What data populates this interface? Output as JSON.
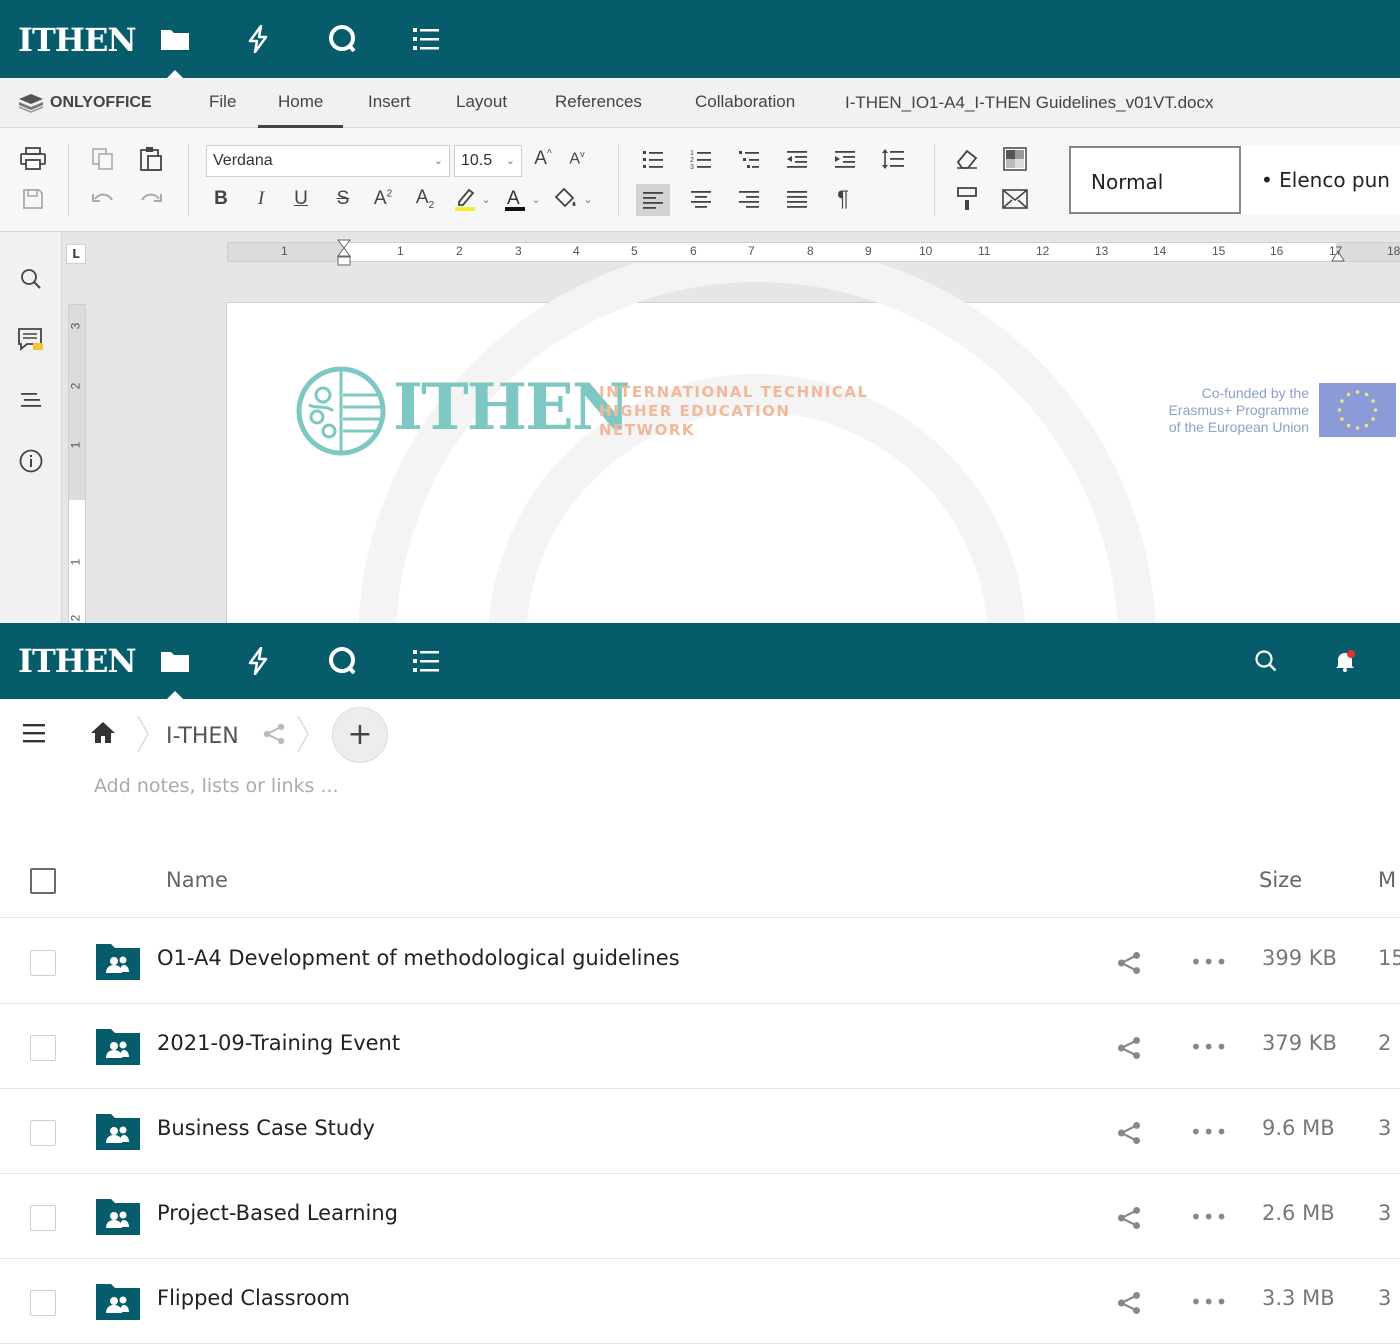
{
  "colors": {
    "header": "#065c6b",
    "ithen_teal": "#7ec8c4",
    "ithen_orange": "#f1b99a",
    "eu_blue": "#8a9bd8"
  },
  "header": {
    "logo": "ITHEN",
    "apps": [
      "files-icon",
      "activity-icon",
      "talk-icon",
      "deck-icon"
    ]
  },
  "editor": {
    "brand": "ONLYOFFICE",
    "tabs": [
      "File",
      "Home",
      "Insert",
      "Layout",
      "References",
      "Collaboration"
    ],
    "active_tab": "Home",
    "document_name": "I-THEN_IO1-A4_I-THEN Guidelines_v01VT.docx",
    "toolbar": {
      "font_name": "Verdana",
      "font_size": "10.5",
      "styles": [
        "Normal",
        "• Elenco pun"
      ]
    },
    "ruler_numbers": [
      "1",
      "1",
      "2",
      "3",
      "4",
      "5",
      "6",
      "7",
      "8",
      "9",
      "10",
      "11",
      "12",
      "13",
      "14",
      "15",
      "16",
      "17",
      "18"
    ],
    "vruler_numbers": [
      "3",
      "2",
      "1",
      "1",
      "2"
    ],
    "page": {
      "logo_word": "ITHEN",
      "logo_sub": [
        "INTERNATIONAL TECHNICAL",
        "HIGHER EDUCATION",
        "NETWORK"
      ],
      "cofund": [
        "Co-funded by the",
        "Erasmus+ Programme",
        "of the European Union"
      ]
    }
  },
  "files": {
    "breadcrumb": "I-THEN",
    "notes_placeholder": "Add notes, lists or links ...",
    "columns": {
      "name": "Name",
      "size": "Size",
      "modified": "M"
    },
    "rows": [
      {
        "name": "O1-A4 Development of methodological guidelines",
        "size": "399 KB",
        "modified": "15"
      },
      {
        "name": "2021-09-Training Event",
        "size": "379 KB",
        "modified": "2"
      },
      {
        "name": "Business Case Study",
        "size": "9.6 MB",
        "modified": "3"
      },
      {
        "name": "Project-Based Learning",
        "size": "2.6 MB",
        "modified": "3"
      },
      {
        "name": "Flipped Classroom",
        "size": "3.3 MB",
        "modified": "3"
      }
    ]
  }
}
